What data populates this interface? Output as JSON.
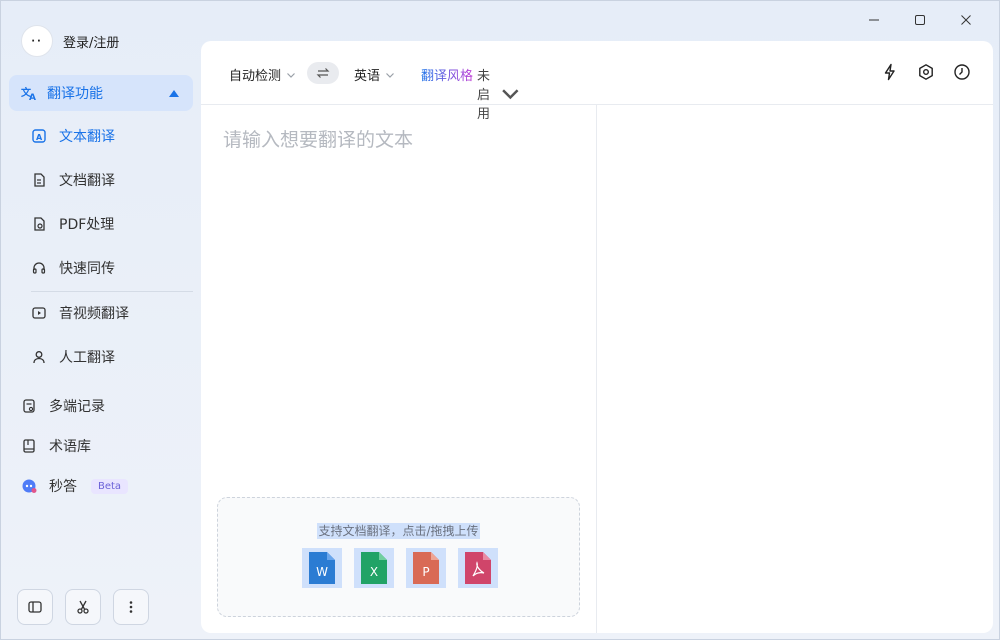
{
  "user": {
    "avatar_text": "··",
    "login_label": "登录/注册"
  },
  "sidebar": {
    "group_label": "翻译功能",
    "sub_items": [
      {
        "label": "文本翻译",
        "icon": "text-translate-icon",
        "active": true
      },
      {
        "label": "文档翻译",
        "icon": "document-icon",
        "active": false
      },
      {
        "label": "PDF处理",
        "icon": "pdf-icon",
        "active": false
      },
      {
        "label": "快速同传",
        "icon": "headset-icon",
        "active": false
      },
      {
        "label": "音视频翻译",
        "icon": "video-icon",
        "active": false
      },
      {
        "label": "人工翻译",
        "icon": "person-icon",
        "active": false
      }
    ],
    "main_items": [
      {
        "label": "多端记录",
        "icon": "records-icon"
      },
      {
        "label": "术语库",
        "icon": "book-icon"
      },
      {
        "label": "秒答",
        "icon": "ai-icon",
        "badge": "Beta"
      }
    ]
  },
  "toolbar": {
    "source_lang": "自动检测",
    "target_lang": "英语",
    "style_label": "翻译风格",
    "style_value": "未启用"
  },
  "editor": {
    "placeholder": "请输入想要翻译的文本"
  },
  "dropzone": {
    "hint": "支持文档翻译，点击/拖拽上传",
    "file_types": [
      {
        "letter": "W",
        "color": "#2b7cd3",
        "icon": "word-file-icon"
      },
      {
        "letter": "X",
        "color": "#21a366",
        "icon": "excel-file-icon"
      },
      {
        "letter": "P",
        "color": "#d24726",
        "icon": "ppt-file-icon"
      },
      {
        "letter": "",
        "color": "#d93b3b",
        "icon": "pdf-file-icon"
      }
    ]
  },
  "colors": {
    "accent": "#1a73e8",
    "active_bg": "#d6e4fb"
  }
}
